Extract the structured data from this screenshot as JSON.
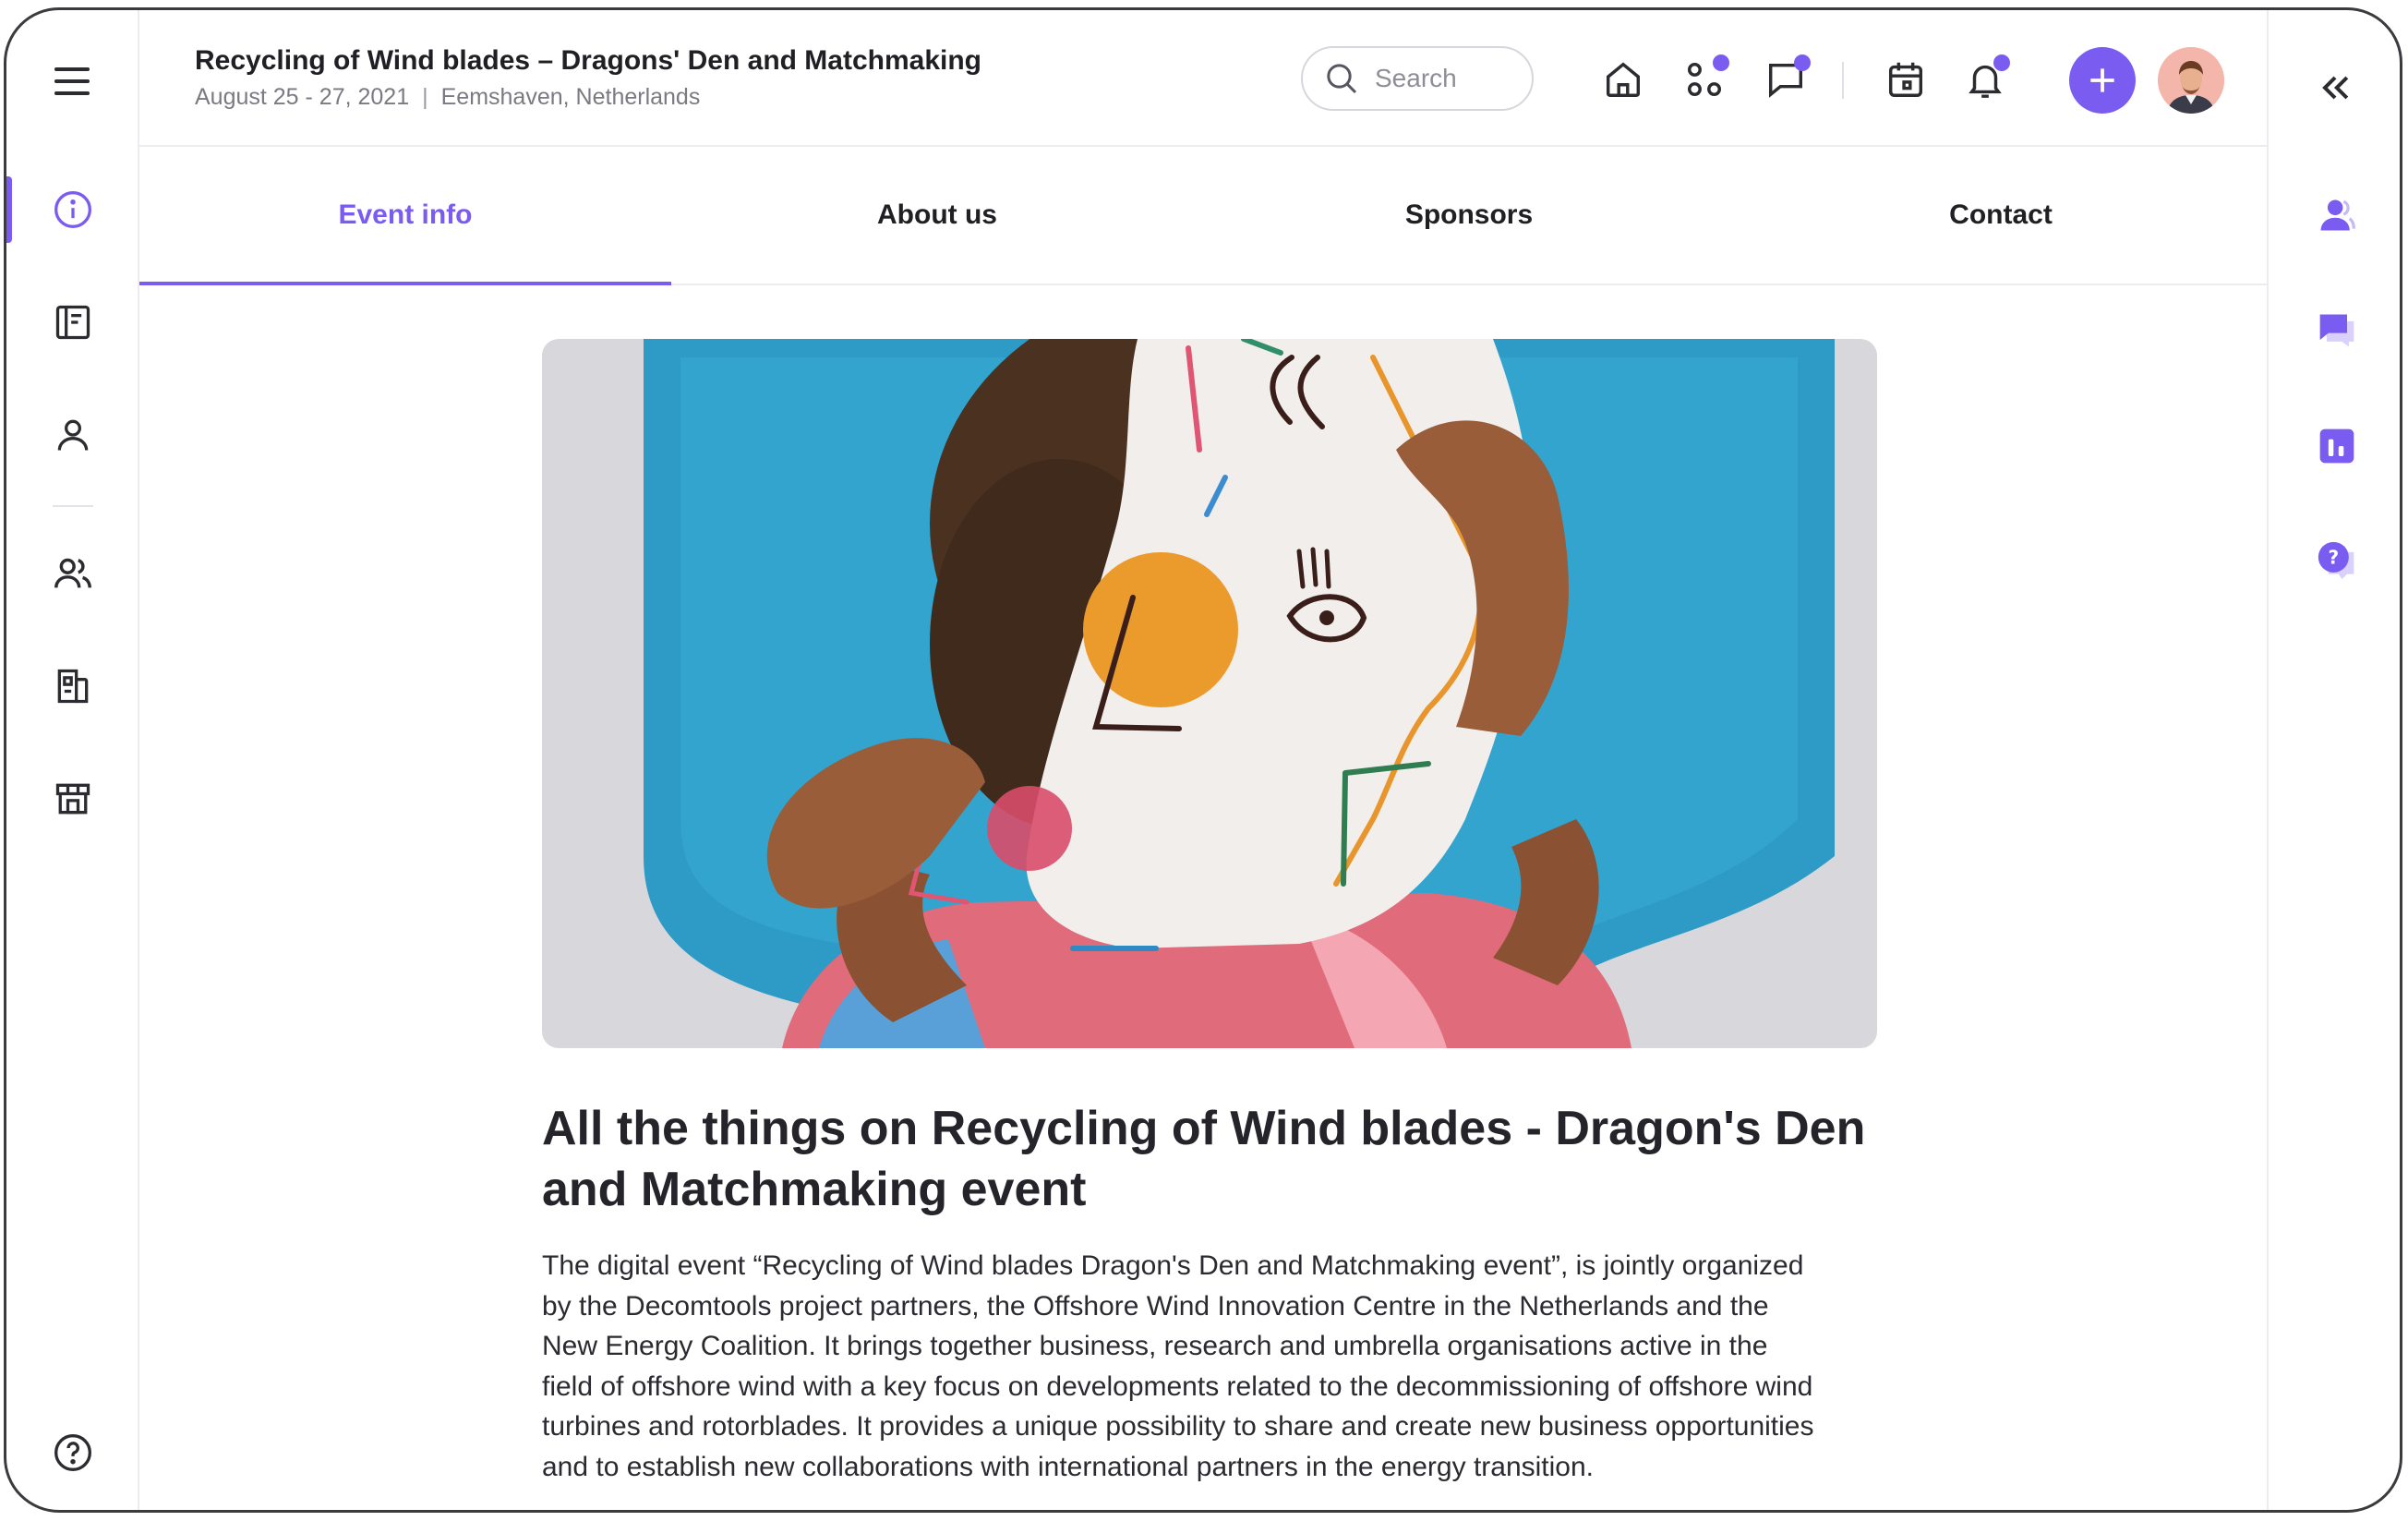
{
  "header": {
    "title": "Recycling of Wind blades – Dragons' Den and Matchmaking",
    "dates": "August 25 - 27, 2021",
    "separator": "|",
    "location": "Eemshaven, Netherlands",
    "search_placeholder": "Search"
  },
  "header_icons": [
    "home-icon",
    "apps-icon",
    "chat-icon",
    "calendar-icon",
    "bell-icon",
    "plus-icon"
  ],
  "left_nav": {
    "items": [
      "info-icon",
      "agenda-icon",
      "profile-icon",
      "people-icon",
      "sponsors-icon",
      "booths-icon"
    ],
    "active": "info-icon",
    "footer": "help-icon"
  },
  "tabs": [
    {
      "label": "Event info",
      "active": true
    },
    {
      "label": "About us",
      "active": false
    },
    {
      "label": "Sponsors",
      "active": false
    },
    {
      "label": "Contact",
      "active": false
    }
  ],
  "right_rail": {
    "items": [
      "collapse-icon",
      "people-icon",
      "chat-icon",
      "poll-icon",
      "question-icon"
    ]
  },
  "main": {
    "headline": "All the things on Recycling of Wind blades - Dragon's Den and Matchmaking event",
    "body": "The digital event “Recycling of Wind blades Dragon's Den and Matchmaking event”, is jointly organized by the Decomtools project partners, the Offshore Wind Innovation Centre in the Netherlands and the New Energy Coalition. It brings together business, research and umbrella organisations active in the field of offshore wind with a key focus on developments related to the decommissioning of offshore wind turbines and rotorblades. It provides a unique possibility to share and create new business opportunities and to establish new collaborations with international partners in the energy transition."
  },
  "colors": {
    "accent": "#7a5cf0",
    "text": "#1f1f24",
    "muted": "#7a7a82",
    "border": "#ececf0"
  }
}
